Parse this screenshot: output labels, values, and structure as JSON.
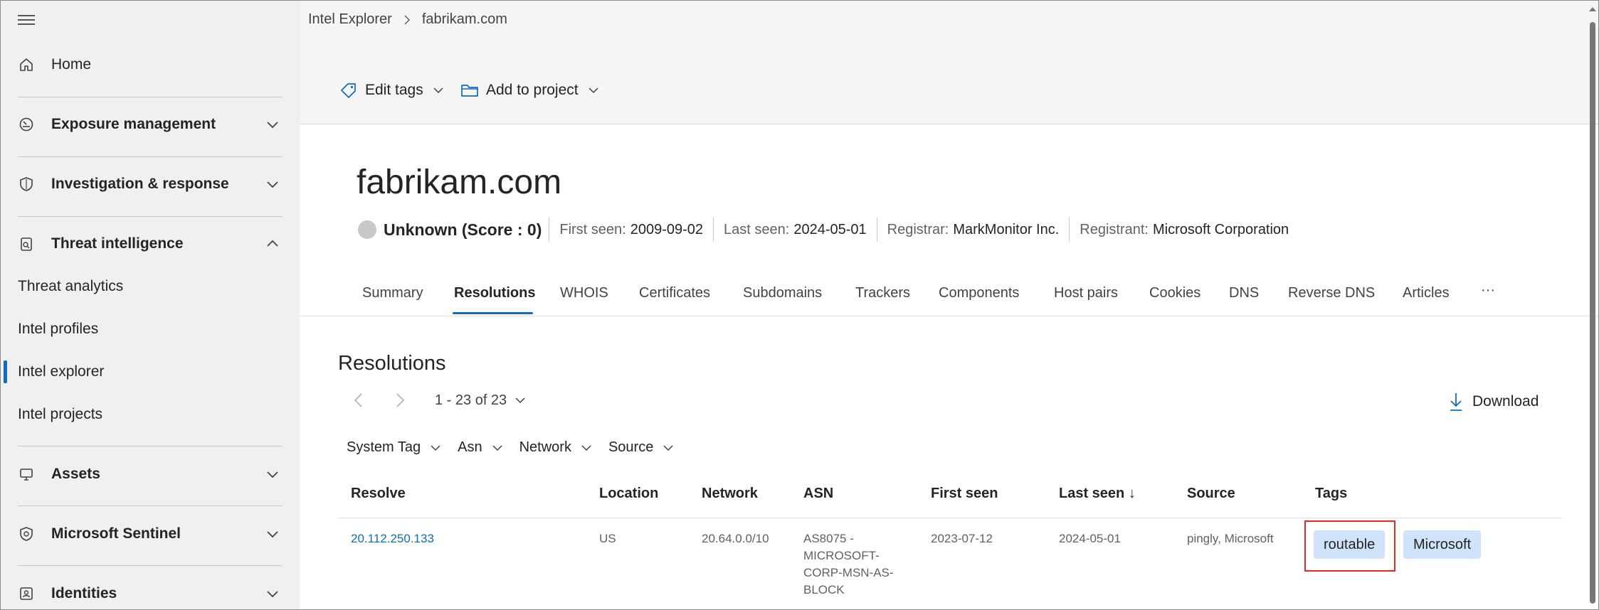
{
  "sidebar": {
    "home": "Home",
    "groups": {
      "exposure": "Exposure management",
      "investigation": "Investigation & response",
      "threat_intel": "Threat intelligence",
      "assets": "Assets",
      "sentinel": "Microsoft Sentinel",
      "identities": "Identities"
    },
    "sub_items": [
      "Threat analytics",
      "Intel profiles",
      "Intel explorer",
      "Intel projects"
    ],
    "active_sub_item": "Intel explorer"
  },
  "breadcrumb": {
    "root": "Intel Explorer",
    "current": "fabrikam.com"
  },
  "toolbar": {
    "edit_tags": "Edit tags",
    "add_to_project": "Add to project"
  },
  "header": {
    "title": "fabrikam.com",
    "reputation": "Unknown (Score : 0)",
    "first_seen_label": "First seen:",
    "first_seen": "2009-09-02",
    "last_seen_label": "Last seen:",
    "last_seen": "2024-05-01",
    "registrar_label": "Registrar:",
    "registrar": "MarkMonitor Inc.",
    "registrant_label": "Registrant:",
    "registrant": "Microsoft Corporation"
  },
  "tabs": [
    "Summary",
    "Resolutions",
    "WHOIS",
    "Certificates",
    "Subdomains",
    "Trackers",
    "Components",
    "Host pairs",
    "Cookies",
    "DNS",
    "Reverse DNS",
    "Articles",
    "···"
  ],
  "active_tab": "Resolutions",
  "resolutions": {
    "title": "Resolutions",
    "pager_text": "1 - 23 of 23",
    "download_label": "Download",
    "filters": [
      "System Tag",
      "Asn",
      "Network",
      "Source"
    ],
    "columns": [
      "Resolve",
      "Location",
      "Network",
      "ASN",
      "First seen",
      "Last seen ↓",
      "Source",
      "Tags"
    ],
    "rows": [
      {
        "resolve": "20.112.250.133",
        "location": "US",
        "network": "20.64.0.0/10",
        "asn": "AS8075 - MICROSOFT-CORP-MSN-AS-BLOCK",
        "asn_lines": [
          "AS8075 -",
          "MICROSOFT-",
          "CORP-MSN-AS-",
          "BLOCK"
        ],
        "first_seen": "2023-07-12",
        "last_seen": "2024-05-01",
        "source": "pingly, Microsoft",
        "tags": [
          "routable",
          "Microsoft"
        ]
      }
    ]
  },
  "colors": {
    "accent": "#0f6cbd",
    "tag_bg": "#cfe4fa",
    "highlight": "#e02a2a",
    "sidebar_bg": "#f0f0f0"
  }
}
